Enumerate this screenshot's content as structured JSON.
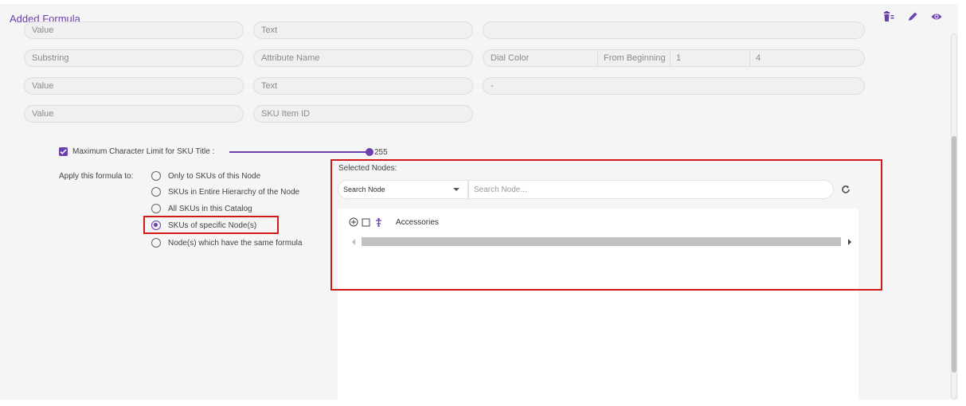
{
  "panel": {
    "title": "Added Formula",
    "header_icons": [
      "delete-icon",
      "edit-icon",
      "eye-icon"
    ]
  },
  "formula_rows": [
    {
      "col1": "Value",
      "col2": "Text",
      "col3": ""
    },
    {
      "col1": "Substring",
      "col2": "Attribute Name",
      "col3_cells": [
        "Dial Color",
        "From Beginning",
        "1",
        "4"
      ]
    },
    {
      "col1": "Value",
      "col2": "Text",
      "col3": "-"
    },
    {
      "col1": "Value",
      "col2": "SKU Item ID"
    }
  ],
  "max_char": {
    "label": "Maximum Character Limit for SKU Title :",
    "checked": true,
    "value": "255"
  },
  "apply": {
    "label": "Apply this formula to:",
    "options": [
      "Only to SKUs of this Node",
      "SKUs in Entire Hierarchy of the Node",
      "All SKUs in this Catalog",
      "SKUs of specific Node(s)",
      "Node(s) which have the same formula"
    ],
    "selected": "SKUs of specific Node(s)"
  },
  "nodes": {
    "label": "Selected Nodes:",
    "dropdown_value": "Search Node",
    "search_placeholder": "Search Node...",
    "tree_items": [
      "Accessories"
    ]
  },
  "colors": {
    "accent": "#6a3fb0",
    "highlight": "#d01a1a"
  }
}
